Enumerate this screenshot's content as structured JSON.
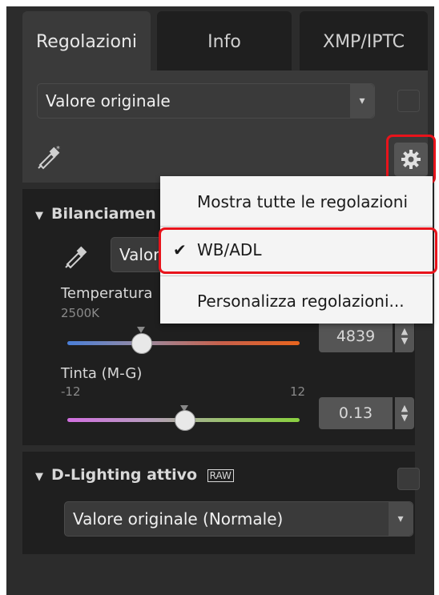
{
  "tabs": [
    {
      "label": "Regolazioni",
      "active": true
    },
    {
      "label": "Info",
      "active": false
    },
    {
      "label": "XMP/IPTC",
      "active": false
    }
  ],
  "top_dropdown": {
    "value": "Valore originale"
  },
  "menu": {
    "items": [
      {
        "label": "Mostra tutte le regolazioni",
        "checked": false
      },
      {
        "label": "WB/ADL",
        "checked": true
      },
      {
        "label": "Personalizza regolazioni...",
        "checked": false
      }
    ],
    "check_glyph": "✔"
  },
  "wb": {
    "title": "Bilanciamen",
    "dropdown_value": "Valor",
    "temperature": {
      "label": "Temperatura",
      "min": "2500K",
      "value": "4839"
    },
    "tint": {
      "label": "Tinta (M-G)",
      "min": "-12",
      "max": "12",
      "value": "0.13"
    }
  },
  "adl": {
    "title": "D-Lighting attivo",
    "badge": "RAW",
    "dropdown_value": "Valore originale (Normale)"
  },
  "colors": {
    "highlight": "#e8131b",
    "panel": "#2c2c2c"
  }
}
